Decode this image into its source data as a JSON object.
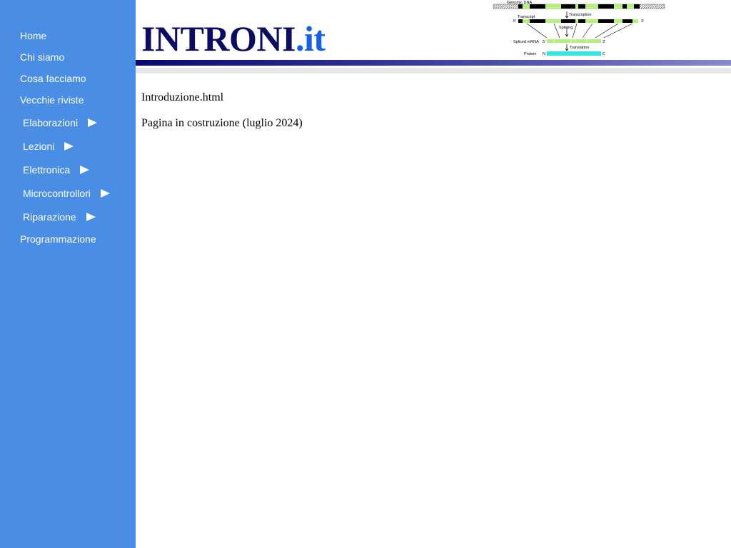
{
  "logo": {
    "name": "INTRONI",
    "tld": ".it"
  },
  "nav": {
    "home": "Home",
    "chi_siamo": "Chi siamo",
    "cosa_facciamo": "Cosa facciamo",
    "vecchie_riviste": "Vecchie riviste",
    "elaborazioni": "Elaborazioni",
    "lezioni": "Lezioni",
    "elettronica": "Elettronica",
    "microcontrollori": "Microcontrollori",
    "riparazione": "Riparazione",
    "programmazione": "Programmazione"
  },
  "diagram": {
    "genomic_dna": "Genomic DNA",
    "transcription": "Transcription",
    "transcript": "Transcript",
    "splicing": "Splicing",
    "spliced_mrna": "Spliced mRNA",
    "translation": "Translation",
    "protein": "Protein",
    "five_prime": "5'",
    "three_prime": "3'",
    "n_term": "N",
    "c_term": "C"
  },
  "content": {
    "filename": "Introduzione.html",
    "status": "Pagina in costruzione (luglio 2024)"
  },
  "colors": {
    "sidebar": "#4a8de5",
    "logo_dark": "#0c0c63",
    "logo_blue": "#1560e8",
    "exon": "#b4f07a",
    "protein": "#33e6e6"
  }
}
